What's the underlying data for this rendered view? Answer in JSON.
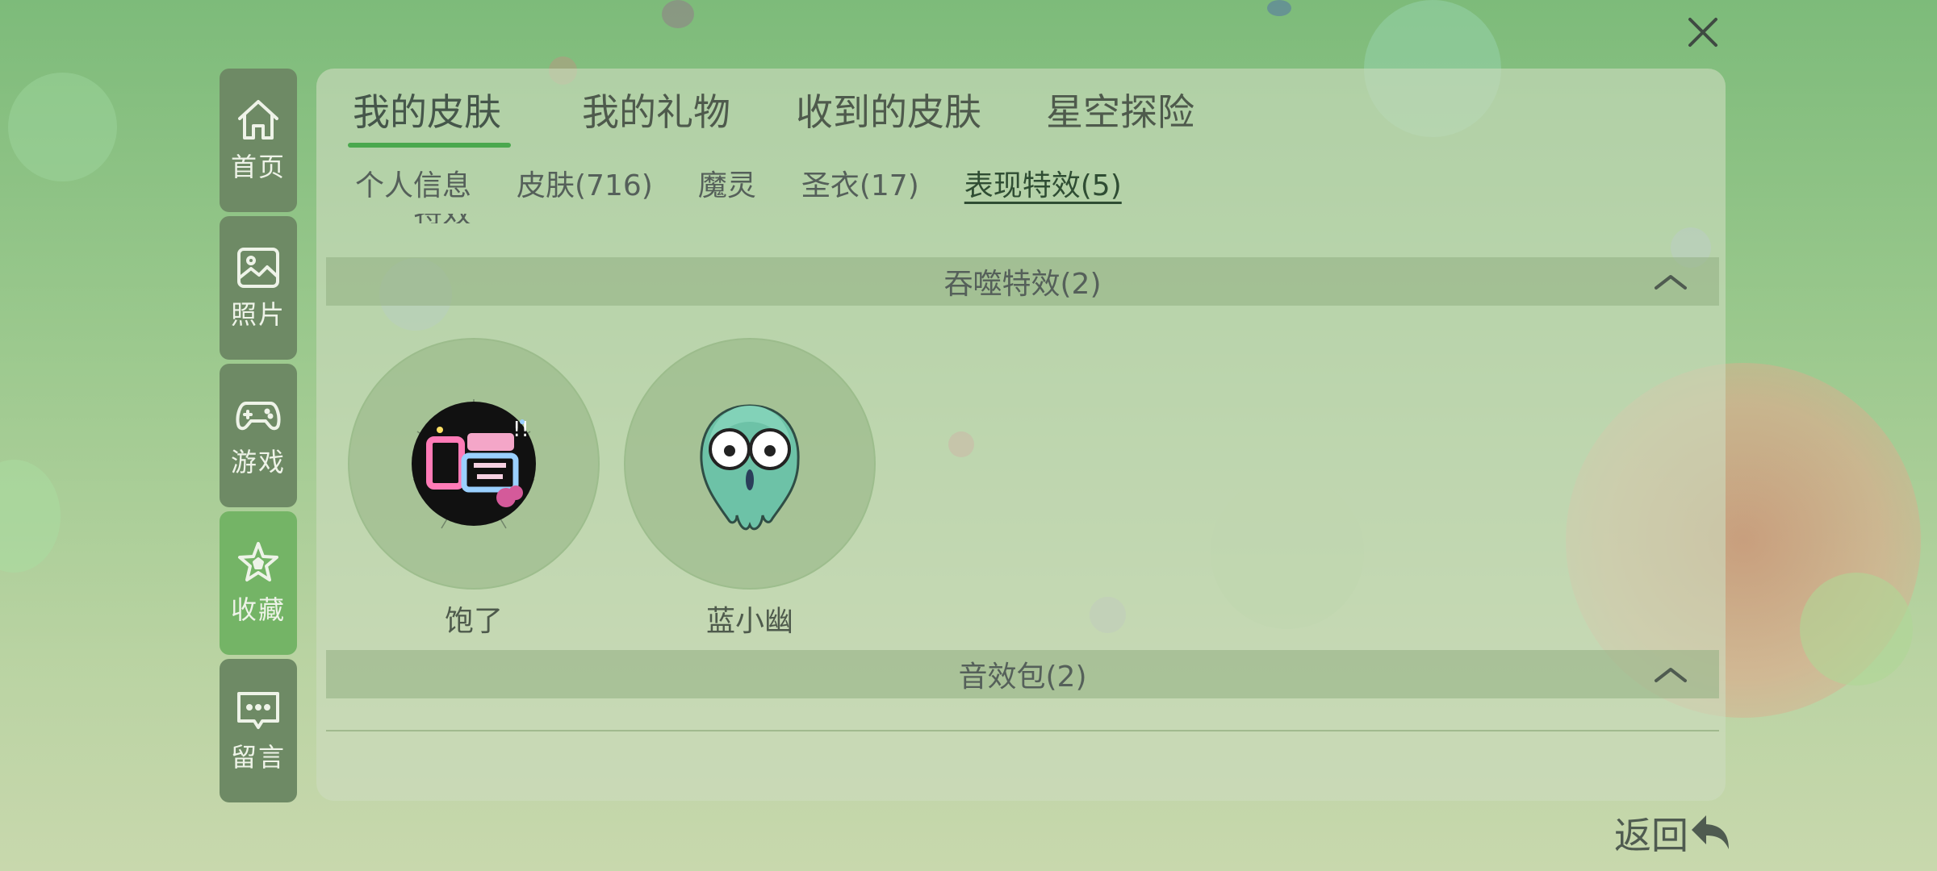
{
  "colors": {
    "nav_bg": "#6e8a65",
    "nav_active": "#74b466",
    "accent": "#4aa84e"
  },
  "close_icon": "close-icon",
  "sidebar": {
    "items": [
      {
        "label": "首页",
        "icon": "home-icon",
        "active": false
      },
      {
        "label": "照片",
        "icon": "image-icon",
        "active": false
      },
      {
        "label": "游戏",
        "icon": "gamepad-icon",
        "active": false
      },
      {
        "label": "收藏",
        "icon": "star-icon",
        "active": true
      },
      {
        "label": "留言",
        "icon": "message-icon",
        "active": false
      }
    ]
  },
  "tabs": [
    "我的皮肤",
    "我的礼物",
    "收到的皮肤",
    "星空探险"
  ],
  "active_tab": "我的皮肤",
  "subtabs": [
    "个人信息",
    "皮肤(716)",
    "魔灵",
    "圣衣(17)",
    "表现特效(5)"
  ],
  "active_subtab": "表现特效(5)",
  "cutoff_text": "特效",
  "sections": [
    {
      "title": "吞噬特效(2)",
      "expanded": true,
      "items": [
        {
          "label": "饱了",
          "icon": "full-badge-icon"
        },
        {
          "label": "蓝小幽",
          "icon": "ghost-icon"
        }
      ]
    },
    {
      "title": "音效包(2)",
      "expanded": true,
      "items": []
    }
  ],
  "back": {
    "label": "返回",
    "icon": "return-arrow-icon"
  }
}
